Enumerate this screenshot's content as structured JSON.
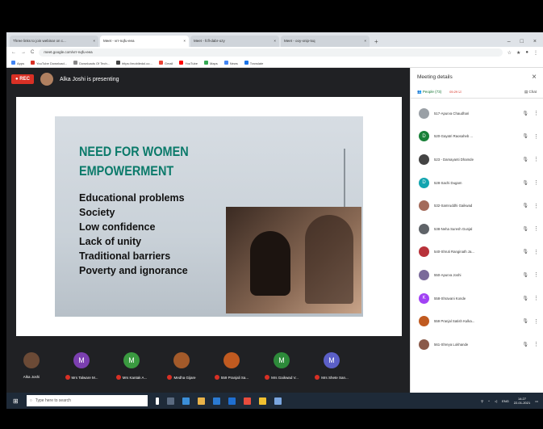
{
  "browser": {
    "tabs": [
      {
        "label": "Three links to join webinar on c..."
      },
      {
        "label": "Meet - vrr-nqfu-eea"
      },
      {
        "label": "Meet - fcfl-dabr-ozy"
      },
      {
        "label": "Meet - ooy-xnip-txq"
      }
    ],
    "url": "meet.google.com/vrr-nqfu-eea",
    "bookmarks": [
      "Apps",
      "YouTube Download...",
      "Downloads Of Tech...",
      "https://mobiledol.co...",
      "Gmail",
      "YouTube",
      "Maps",
      "News",
      "Translate"
    ]
  },
  "meet": {
    "rec_label": "REC",
    "presenter_text": "Alka Joshi is presenting",
    "slide": {
      "title_line1": "NEED FOR WOMEN",
      "title_line2": "EMPOWERMENT",
      "bullets": [
        "Educational problems",
        "Society",
        "Low confidence",
        "Lack of unity",
        "Traditional barriers",
        "Poverty and ignorance"
      ]
    },
    "participants": [
      {
        "initial": "",
        "name": "Alka Joshi",
        "color": "#6b4a36"
      },
      {
        "initial": "M",
        "name": "Mrs Talware M...",
        "color": "#7b3fb0"
      },
      {
        "initial": "M",
        "name": "Mrs Kantak A...",
        "color": "#3a9a40"
      },
      {
        "initial": "",
        "name": "Medha Gijare",
        "color": "#a35a2a"
      },
      {
        "initial": "",
        "name": "559 Pranjali Sa...",
        "color": "#c05a20"
      },
      {
        "initial": "M",
        "name": "Mrs Gaikwad V...",
        "color": "#2d8a3a"
      },
      {
        "initial": "M",
        "name": "Mrs Shete San...",
        "color": "#5b5fc7"
      }
    ]
  },
  "panel": {
    "title": "Meeting details",
    "people_tab": "People (73)",
    "time_badge": "05:29",
    "chat_tab": "Chat",
    "people": [
      {
        "initial": "",
        "name": "517-Apurva Chaudhari",
        "color": "#9aa0a6"
      },
      {
        "initial": "D",
        "name": "520-Gayatri Raosaheb ...",
        "color": "#188038"
      },
      {
        "initial": "",
        "name": "523 - Damayanti Dhamde",
        "color": "#444"
      },
      {
        "initial": "D",
        "name": "528-Sachi Dugam",
        "color": "#12a4af"
      },
      {
        "initial": "",
        "name": "532-Samruddhi Gaikwad",
        "color": "#a36a5a"
      },
      {
        "initial": "",
        "name": "538-Neha Suresh Gunjal",
        "color": "#5f6368"
      },
      {
        "initial": "",
        "name": "540-Shruti Ranginath Ja...",
        "color": "#b8323a"
      },
      {
        "initial": "",
        "name": "550-Apurva Joshi",
        "color": "#7a6a9a"
      },
      {
        "initial": "K",
        "name": "558-Shravani Konde",
        "color": "#a142f4"
      },
      {
        "initial": "",
        "name": "559 Pranjal Satish Kulka...",
        "color": "#c05a20"
      },
      {
        "initial": "",
        "name": "561-Shreya Lokhande",
        "color": "#8a5a4a"
      }
    ]
  },
  "taskbar": {
    "search_placeholder": "Type here to search",
    "lang": "ENG",
    "time": "14:27",
    "date": "22-01-2021"
  }
}
